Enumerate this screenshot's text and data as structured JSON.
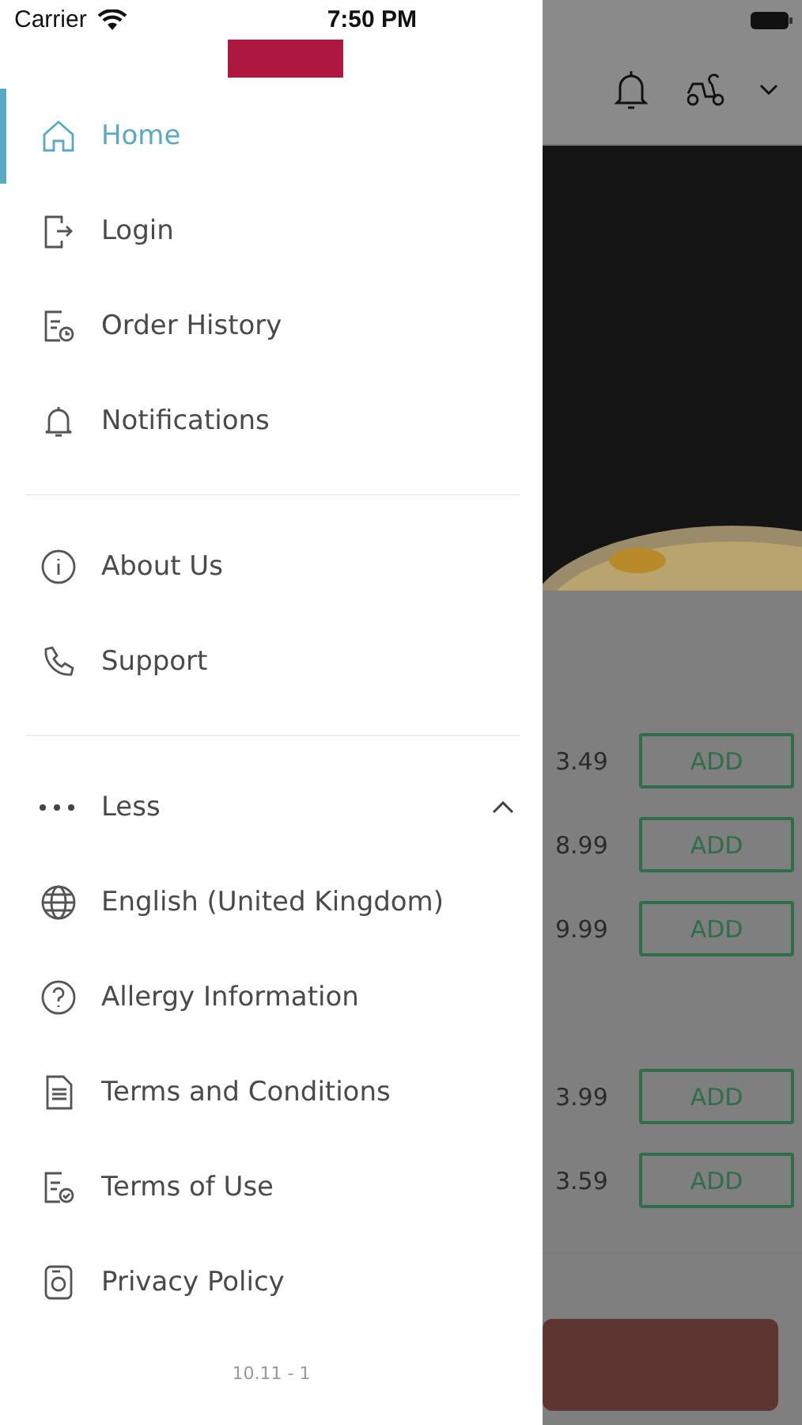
{
  "status_bar": {
    "carrier": "Carrier",
    "time": "7:50 PM"
  },
  "menu": {
    "sections": [
      [
        {
          "label": "Home",
          "selected": true
        },
        {
          "label": "Login",
          "selected": false
        },
        {
          "label": "Order History",
          "selected": false
        },
        {
          "label": "Notifications",
          "selected": false
        }
      ],
      [
        {
          "label": "About Us",
          "selected": false
        },
        {
          "label": "Support",
          "selected": false
        }
      ]
    ],
    "expander": {
      "label": "Less",
      "expanded": true
    },
    "more_items": [
      {
        "label": "English (United Kingdom)",
        "selected": false
      },
      {
        "label": "Allergy Information",
        "selected": false
      },
      {
        "label": "Terms and Conditions",
        "selected": false
      },
      {
        "label": "Terms of Use",
        "selected": false
      },
      {
        "label": "Privacy Policy",
        "selected": false
      }
    ],
    "version": "10.11 - 1"
  },
  "background": {
    "product_groups": [
      [
        {
          "price": "3.49",
          "button": "ADD"
        },
        {
          "price": "8.99",
          "button": "ADD"
        },
        {
          "price": "9.99",
          "button": "ADD"
        }
      ],
      [
        {
          "price": "3.99",
          "button": "ADD"
        },
        {
          "price": "3.59",
          "button": "ADD"
        }
      ]
    ]
  }
}
